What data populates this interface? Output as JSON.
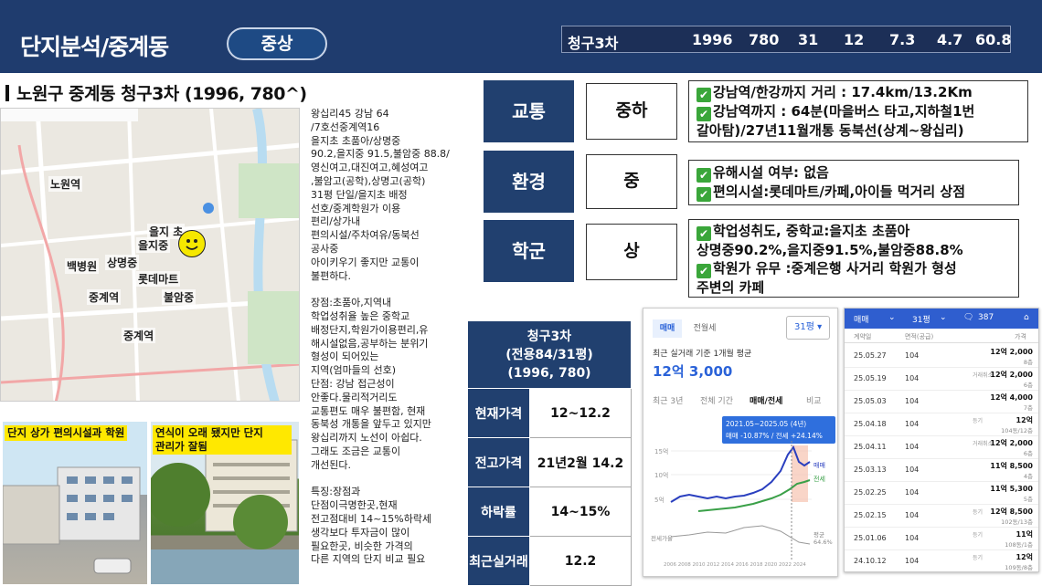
{
  "header": {
    "title": "단지분석/중계동",
    "grade": "중상",
    "summary": {
      "name": "청구3차",
      "year": "1996",
      "households": "780",
      "v1": "31",
      "v2": "12",
      "v3": "7.3",
      "v4": "4.7",
      "v5": "60.8"
    }
  },
  "subtitle": "노원구 중계동 청구3차 (1996, 780^)",
  "map": {
    "labels": {
      "nowon": "노원역",
      "eulji_cho": "을지 초",
      "eulji_jung": "을지중",
      "baekbyeong": "백병원",
      "sangmyeong": "상명중",
      "lotte": "롯데마트",
      "junggye_station": "중계역",
      "buram": "불암중",
      "junggye_station2": "중계역"
    }
  },
  "description": "왕십리45 강남 64\n/7호선중계역16\n을지초 초품아/상명중\n90.2,을지중 91.5,불암중 88.8/\n영신여고,대진여고,혜성여고\n,불암고(공학),상명고(공학)\n31평 단일/을지초 배정\n선호/중계학원가 이용\n편리/상가내\n편의시설/주차여유/동북선\n공사중\n아이키우기 좋지만 교통이\n불편하다.\n\n장점:초품아,지역내\n학업성취율 높은 중학교\n배정단지,학원가이용편리,유\n해시설없음,공부하는 분위기\n형성이 되어있는\n지역(엄마들의 선호)\n단점: 강남 접근성이\n안좋다.물리적거리도\n교통편도 매우 불편함, 현재\n동북성 개통을 앞두고 있지만\n왕십리까지 노선이 아쉽다.\n그래도 조금은 교통이\n개선된다.\n\n특징:장점과\n단점이극명한곳,현재\n전고점대비 14~15%하락세\n생각보다 투자금이 많이\n필요한곳, 비슷한 가격의\n다른 지역의 단지 비교 필요",
  "photos": {
    "caption1": "단지 상가 편의시설과 학원",
    "caption2": "연식이 오래 됐지만 단지\n관리가 잘됨"
  },
  "categories": [
    {
      "name": "교통",
      "grade": "중하",
      "details": [
        "강남역/한강까지 거리 : 17.4km/13.2Km",
        "강남역까지 : 64분(마을버스 타고,지하철1번",
        "갈아탐)/27년11월개통 동북선(상계~왕십리)"
      ]
    },
    {
      "name": "환경",
      "grade": "중",
      "details": [
        "유해시설 여부: 없음",
        "편의시설:롯데마트/카페,아이들 먹거리 상점"
      ]
    },
    {
      "name": "학군",
      "grade": "상",
      "details": [
        "학업성취도, 중학교:을지초 초품아",
        "상명중90.2%,을지중91.5%,불암중88.8%",
        "학원가 유무 :중계은행 사거리 학원가 형성",
        "주변의 카페"
      ]
    }
  ],
  "price_table": {
    "header": "청구3차\n(전용84/31평)\n(1996, 780)",
    "rows": [
      {
        "label": "현재가격",
        "value": "12~12.2"
      },
      {
        "label": "전고가격",
        "value": "21년2월  14.2"
      },
      {
        "label": "하락률",
        "value": "14~15%"
      },
      {
        "label": "최근실거래",
        "value": "12.2"
      }
    ]
  },
  "chart_panel": {
    "tab_sale": "매매",
    "tab_rent": "전월세",
    "size_select": "31평",
    "caption": "최근 실거래 기준 1개월 평균",
    "price": "12억 3,000",
    "period_tabs": [
      "최근 3년",
      "전체 기간",
      "매매/전세",
      "비교"
    ],
    "tooltip_period": "2021.05~2025.05 (4년)",
    "tooltip_change": "매매 -10.87%  /  전세 +24.14%",
    "legend_sale": "매매",
    "legend_rent": "전세",
    "ratio_label": "전세가율",
    "ratio_value": "평균\n64.6%",
    "yticks": [
      "15억",
      "10억",
      "5억"
    ],
    "xticks": "2006 2008 2010 2012 2014 2016 2018 2020 2022 2024"
  },
  "list_panel": {
    "tab": "매매",
    "size": "31평",
    "comments": "387",
    "col_date": "계약일",
    "col_area": "면적(공급)",
    "col_price": "가격",
    "rows": [
      {
        "date": "25.05.27",
        "area": "104",
        "price": "12억 2,000",
        "floor": "8층"
      },
      {
        "date": "25.05.19",
        "area": "104",
        "price": "12억 2,000",
        "floor": "6층",
        "tag": "거래취소"
      },
      {
        "date": "25.05.03",
        "area": "104",
        "price": "12억 4,000",
        "floor": "7층"
      },
      {
        "date": "25.04.18",
        "area": "104",
        "price": "12억",
        "floor": "104동/12층",
        "tag": "등기"
      },
      {
        "date": "25.04.11",
        "area": "104",
        "price": "12억 2,000",
        "floor": "6층",
        "tag": "거래취소"
      },
      {
        "date": "25.03.13",
        "area": "104",
        "price": "11억 8,500",
        "floor": "4층"
      },
      {
        "date": "25.02.25",
        "area": "104",
        "price": "11억 5,300",
        "floor": "5층"
      },
      {
        "date": "25.02.15",
        "area": "104",
        "price": "12억 8,500",
        "floor": "102동/13층",
        "tag": "등기"
      },
      {
        "date": "25.01.06",
        "area": "104",
        "price": "11억",
        "floor": "108동/1층",
        "tag": "등기"
      },
      {
        "date": "24.10.12",
        "area": "104",
        "price": "12억",
        "floor": "109동/8층",
        "tag": "등기"
      }
    ]
  }
}
